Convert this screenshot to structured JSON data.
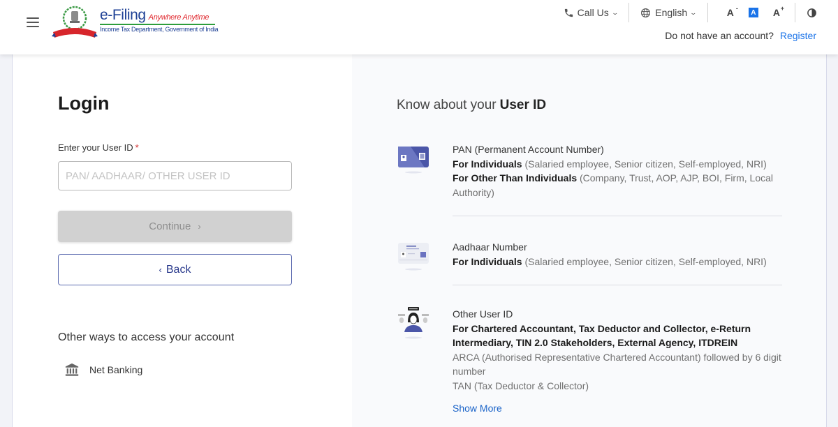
{
  "header": {
    "logo": {
      "title": "e-Filing",
      "tagline": "Anywhere Anytime",
      "subtitle": "Income Tax Department, Government of India"
    },
    "call_us": "Call Us",
    "language": "English",
    "font_decrease": "A",
    "font_default": "A",
    "font_increase": "A",
    "register_prompt": "Do not have an account?",
    "register_link": "Register"
  },
  "login": {
    "title": "Login",
    "field_label": "Enter your User ID",
    "required_mark": "*",
    "input_placeholder": "PAN/ AADHAAR/ OTHER USER ID",
    "input_value": "",
    "continue_label": "Continue",
    "continue_arrow": "›",
    "back_arrow": "‹",
    "back_label": "Back",
    "other_ways_title": "Other ways to access your account",
    "net_banking_label": "Net Banking"
  },
  "know": {
    "title_prefix": "Know about your",
    "title_bold": "User ID",
    "items": [
      {
        "icon": "pan-card-icon",
        "title": "PAN (Permanent Account Number)",
        "line1_bold": "For Individuals",
        "line1_rest": " (Salaried employee, Senior citizen, Self-employed, NRI)",
        "line2_bold": "For Other Than Individuals",
        "line2_rest": " (Company, Trust, AOP, AJP, BOI, Firm, Local Authority)"
      },
      {
        "icon": "aadhaar-card-icon",
        "title": "Aadhaar Number",
        "line1_bold": "For Individuals",
        "line1_rest": " (Salaried employee, Senior citizen, Self-employed, NRI)"
      },
      {
        "icon": "other-user-icon",
        "title": "Other User ID",
        "bold_text": "For Chartered Accountant, Tax Deductor and Collector, e-Return Intermediary, TIN 2.0 Stakeholders, External Agency, ITDREIN",
        "detail1": "ARCA (Authorised Representative Chartered Accountant) followed by 6 digit number",
        "detail2": "TAN (Tax Deductor & Collector)",
        "show_more": "Show More"
      }
    ]
  },
  "colors": {
    "brand_blue": "#1c3f94",
    "link_blue": "#1a73e8",
    "tagline_red": "#e0282e",
    "logo_green": "#2d9d3b",
    "disabled_gray": "#d1d1d1"
  }
}
